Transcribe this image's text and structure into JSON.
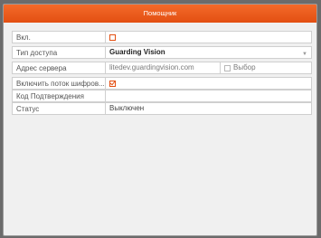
{
  "window": {
    "title": "Помощник"
  },
  "form": {
    "enable": {
      "label": "Вкл.",
      "checked": false
    },
    "access_type": {
      "label": "Тип доступа",
      "value": "Guarding Vision"
    },
    "server_address": {
      "label": "Адрес сервера",
      "value": "litedev.guardingvision.com",
      "option_label": "Выбор",
      "option_checked": false
    },
    "stream_encryption": {
      "label": "Включить поток шифров...",
      "checked": true
    },
    "verification_code": {
      "label": "Код Подтверждения",
      "value": ""
    },
    "status": {
      "label": "Статус",
      "value": "Выключен"
    }
  },
  "colors": {
    "accent": "#e34f12",
    "titlebar": "#f26428",
    "background": "#f0f0f0"
  },
  "icons": {
    "dropdown": "chevron-down-icon"
  }
}
